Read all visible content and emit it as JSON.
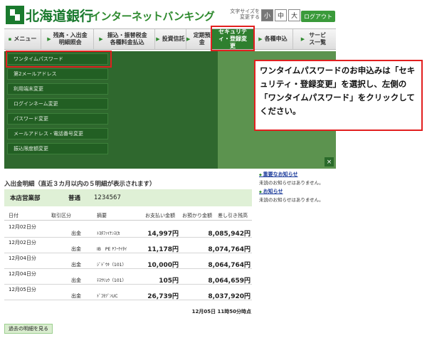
{
  "header": {
    "bank_name": "北海道銀行",
    "service_name": "インターネットバンキング",
    "text_size_label": "文字サイズを変更する",
    "text_size_small": "小",
    "text_size_medium": "中",
    "text_size_large": "大",
    "logout": "ログアウト"
  },
  "nav": {
    "menu": "メニュー",
    "balance": "残高・入出金明細照会",
    "transfer": "振込・振替税金各種料金払込",
    "investment": "投資信託",
    "fixed_deposit": "定期預金",
    "security": "セキュリティ・登録変更",
    "application": "各種申込",
    "service": "サービス一覧"
  },
  "security_menu": [
    "ワンタイムパスワード",
    "第2メールアドレス",
    "利用端末変更",
    "ログインネーム変更",
    "パスワード変更",
    "メールアドレス・電話番号変更",
    "振込限度額変更"
  ],
  "callout": "ワンタイムパスワードのお申込みは「セキュリティ・登録変更」を選択し、左側の「ワンタイムパスワード」をクリックしてください。",
  "panel_close": "×",
  "transactions": {
    "title": "入出金明細（直近３カ月以内の５明細が表示されます）",
    "branch": "本店営業部",
    "account_type": "普通",
    "account_number": "1234567",
    "headers": {
      "date": "日付",
      "kind": "取引区分",
      "description": "摘要",
      "payment": "お支払い金額",
      "deposit": "お預かり金額",
      "balance": "差し引き残高"
    },
    "rows": [
      {
        "date": "12月02日分",
        "kind": "出金",
        "description": "ﾄﾖﾀﾌｧｲﾅﾝｽ(ｶ",
        "payment": "14,997円",
        "deposit": "",
        "balance": "8,085,942円"
      },
      {
        "date": "12月02日分",
        "kind": "出金",
        "description": "IB　PE ﾔﾌｰｹｲﾀｲ",
        "payment": "11,178円",
        "deposit": "",
        "balance": "8,074,764円"
      },
      {
        "date": "12月04日分",
        "kind": "出金",
        "description": "ｼﾞﾄﾞｳｷ（101）",
        "payment": "10,000円",
        "deposit": "",
        "balance": "8,064,764円"
      },
      {
        "date": "12月04日分",
        "kind": "出金",
        "description": "ﾃｽｳﾘｮｳ（101）",
        "payment": "105円",
        "deposit": "",
        "balance": "8,064,659円"
      },
      {
        "date": "12月05日分",
        "kind": "出金",
        "description": "ﾄﾞｺﾓﾂﾞﾝUC",
        "payment": "26,739円",
        "deposit": "",
        "balance": "8,037,920円"
      }
    ],
    "timestamp": "12月05日 11時50分時点",
    "past_button": "過去の明細を見る"
  },
  "notices": [
    {
      "title": "重要なお知らせ",
      "body": "未読のお知らせはありません。"
    },
    {
      "title": "お知らせ",
      "body": "未読のお知らせはありません。"
    }
  ]
}
